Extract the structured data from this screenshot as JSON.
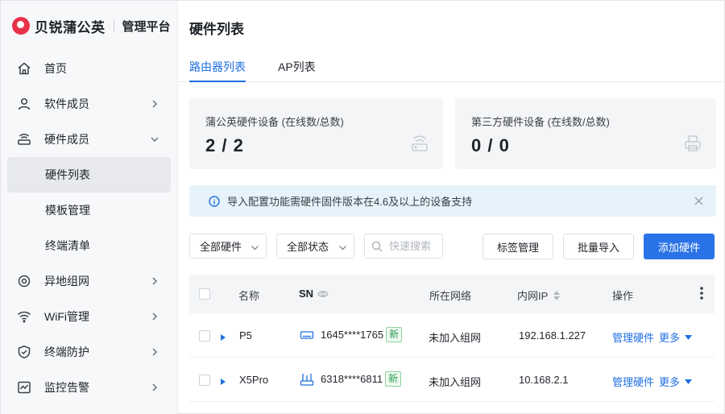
{
  "brand": {
    "name": "贝锐蒲公英",
    "subtitle": "管理平台"
  },
  "sidebar": {
    "items": [
      {
        "label": "首页",
        "icon": "home-icon"
      },
      {
        "label": "软件成员",
        "icon": "user-icon"
      },
      {
        "label": "硬件成员",
        "icon": "router-icon",
        "expanded": true,
        "children": [
          {
            "label": "硬件列表",
            "active": true
          },
          {
            "label": "模板管理"
          },
          {
            "label": "终端清单"
          }
        ]
      },
      {
        "label": "异地组网",
        "icon": "network-icon"
      },
      {
        "label": "WiFi管理",
        "icon": "wifi-icon"
      },
      {
        "label": "终端防护",
        "icon": "shield-icon"
      },
      {
        "label": "监控告警",
        "icon": "monitor-icon"
      }
    ]
  },
  "page": {
    "title": "硬件列表"
  },
  "tabs": [
    {
      "label": "路由器列表",
      "active": true
    },
    {
      "label": "AP列表",
      "active": false
    }
  ],
  "stats": [
    {
      "label": "蒲公英硬件设备 (在线数/总数)",
      "value": "2 / 2",
      "icon": "router-device-icon"
    },
    {
      "label": "第三方硬件设备 (在线数/总数)",
      "value": "0 / 0",
      "icon": "printer-device-icon"
    }
  ],
  "notice": {
    "text": "导入配置功能需硬件固件版本在4.6及以上的设备支持"
  },
  "filters": {
    "hardware": "全部硬件",
    "status": "全部状态",
    "search_placeholder": "快速搜索"
  },
  "buttons": {
    "tags": "标签管理",
    "import": "批量导入",
    "add": "添加硬件"
  },
  "table": {
    "columns": {
      "name": "名称",
      "sn": "SN",
      "network": "所在网络",
      "ip": "内网IP",
      "actions": "操作"
    },
    "rows": [
      {
        "name": "P5",
        "sn": "1645****1765",
        "badge": "新",
        "network": "未加入组网",
        "ip": "192.168.1.227",
        "manage": "管理硬件",
        "more": "更多",
        "device_icon": "router-box-icon"
      },
      {
        "name": "X5Pro",
        "sn": "6318****6811",
        "badge": "新",
        "network": "未加入组网",
        "ip": "10.168.2.1",
        "manage": "管理硬件",
        "more": "更多",
        "device_icon": "router-antenna-icon"
      }
    ]
  },
  "colors": {
    "accent": "#1f6fe0",
    "primary_button": "#2a73e6",
    "badge_green": "#2d9c52",
    "notice_bg": "#e6f3fb"
  }
}
